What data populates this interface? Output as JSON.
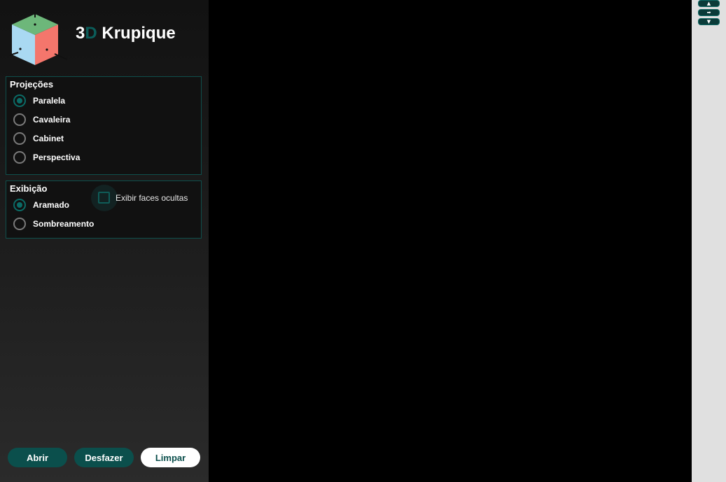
{
  "app": {
    "title_num": "3",
    "title_d": "D",
    "title_name": "Krupique",
    "accent_color": "#0b5d5a"
  },
  "projections": {
    "title": "Projeções",
    "options": [
      {
        "label": "Paralela",
        "checked": true
      },
      {
        "label": "Cavaleira",
        "checked": false
      },
      {
        "label": "Cabinet",
        "checked": false
      },
      {
        "label": "Perspectiva",
        "checked": false
      }
    ]
  },
  "display": {
    "title": "Exibição",
    "options": [
      {
        "label": "Aramado",
        "checked": true
      },
      {
        "label": "Sombreamento",
        "checked": false
      }
    ],
    "hidden_faces_label": "Exibir faces ocultas",
    "hidden_faces_checked": false
  },
  "buttons": {
    "open": "Abrir",
    "undo": "Desfazer",
    "clear": "Limpar"
  },
  "rotation_controls": [
    {
      "icon": "arrow-up-icon",
      "glyph": "▲"
    },
    {
      "icon": "arrow-right-icon",
      "glyph": "➡"
    },
    {
      "icon": "arrow-down-icon",
      "glyph": "▼"
    }
  ]
}
